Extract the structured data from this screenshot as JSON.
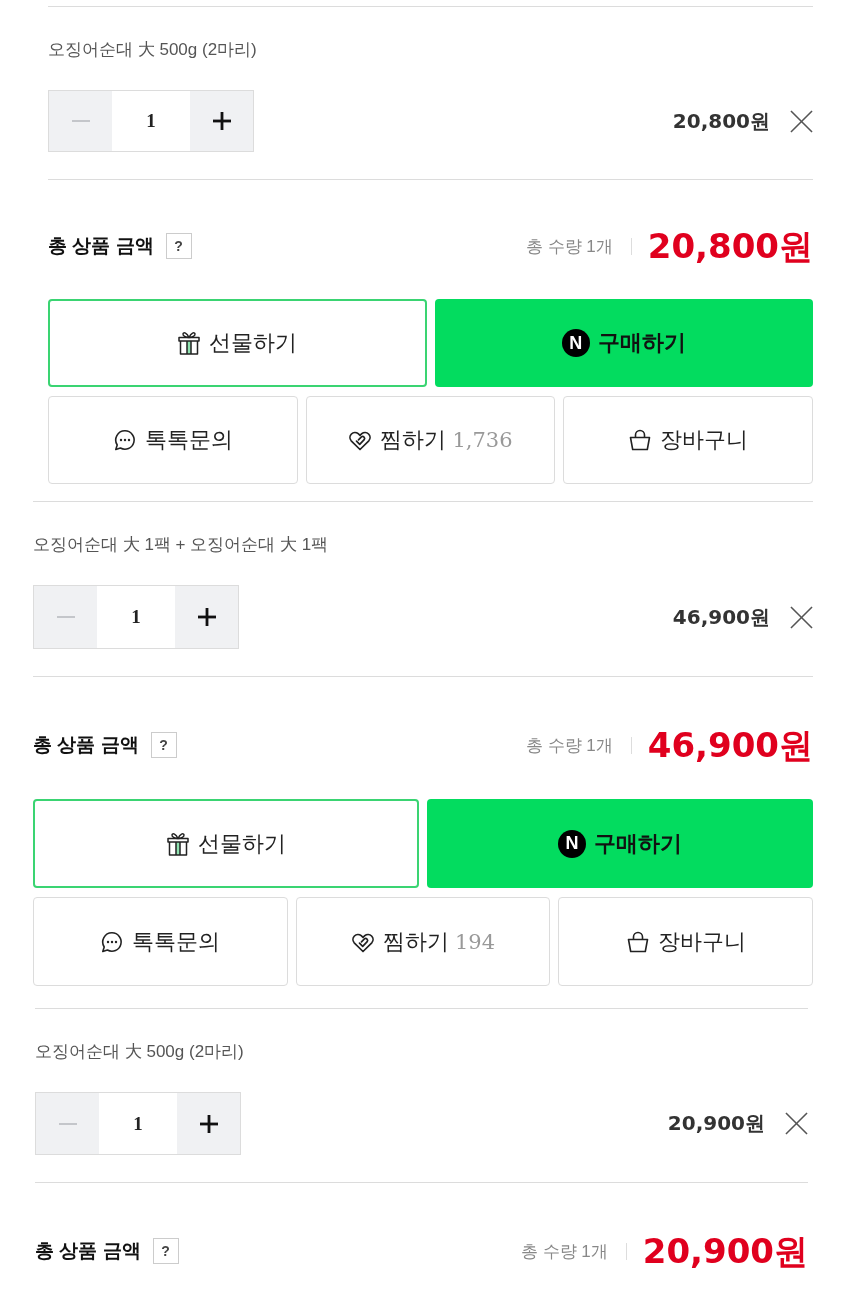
{
  "panels": [
    {
      "option": {
        "name": "오징어순대 大 500g (2마리)",
        "quantity": "1",
        "decrease_disabled": true,
        "increase_disabled": false,
        "price": "20,800원"
      },
      "total": {
        "label": "총 상품 금액",
        "help": "?",
        "quantity": "총 수량 1개",
        "amount": "20,800원"
      },
      "primary_buttons": [
        {
          "kind": "gift",
          "label": "선물하기"
        },
        {
          "kind": "buy",
          "label": "구매하기",
          "icon_text": "N"
        }
      ],
      "secondary_buttons": [
        {
          "kind": "talk",
          "label": "톡톡문의"
        },
        {
          "kind": "wish",
          "label": "찜하기",
          "count": "1,736"
        },
        {
          "kind": "cart",
          "label": "장바구니"
        }
      ]
    },
    {
      "option": {
        "name": "오징어순대 大 1팩 + 오징어순대 大 1팩",
        "quantity": "1",
        "decrease_disabled": true,
        "increase_disabled": false,
        "price": "46,900원"
      },
      "total": {
        "label": "총 상품 금액",
        "help": "?",
        "quantity": "총 수량 1개",
        "amount": "46,900원"
      },
      "primary_buttons": [
        {
          "kind": "gift",
          "label": "선물하기"
        },
        {
          "kind": "buy",
          "label": "구매하기",
          "icon_text": "N"
        }
      ],
      "secondary_buttons": [
        {
          "kind": "talk",
          "label": "톡톡문의"
        },
        {
          "kind": "wish",
          "label": "찜하기",
          "count": "194"
        },
        {
          "kind": "cart",
          "label": "장바구니"
        }
      ]
    },
    {
      "option": {
        "name": "오징어순대 大 500g (2마리)",
        "quantity": "1",
        "decrease_disabled": true,
        "increase_disabled": false,
        "price": "20,900원"
      },
      "total": {
        "label": "총 상품 금액",
        "help": "?",
        "quantity": "총 수량 1개",
        "amount": "20,900원"
      }
    }
  ]
}
